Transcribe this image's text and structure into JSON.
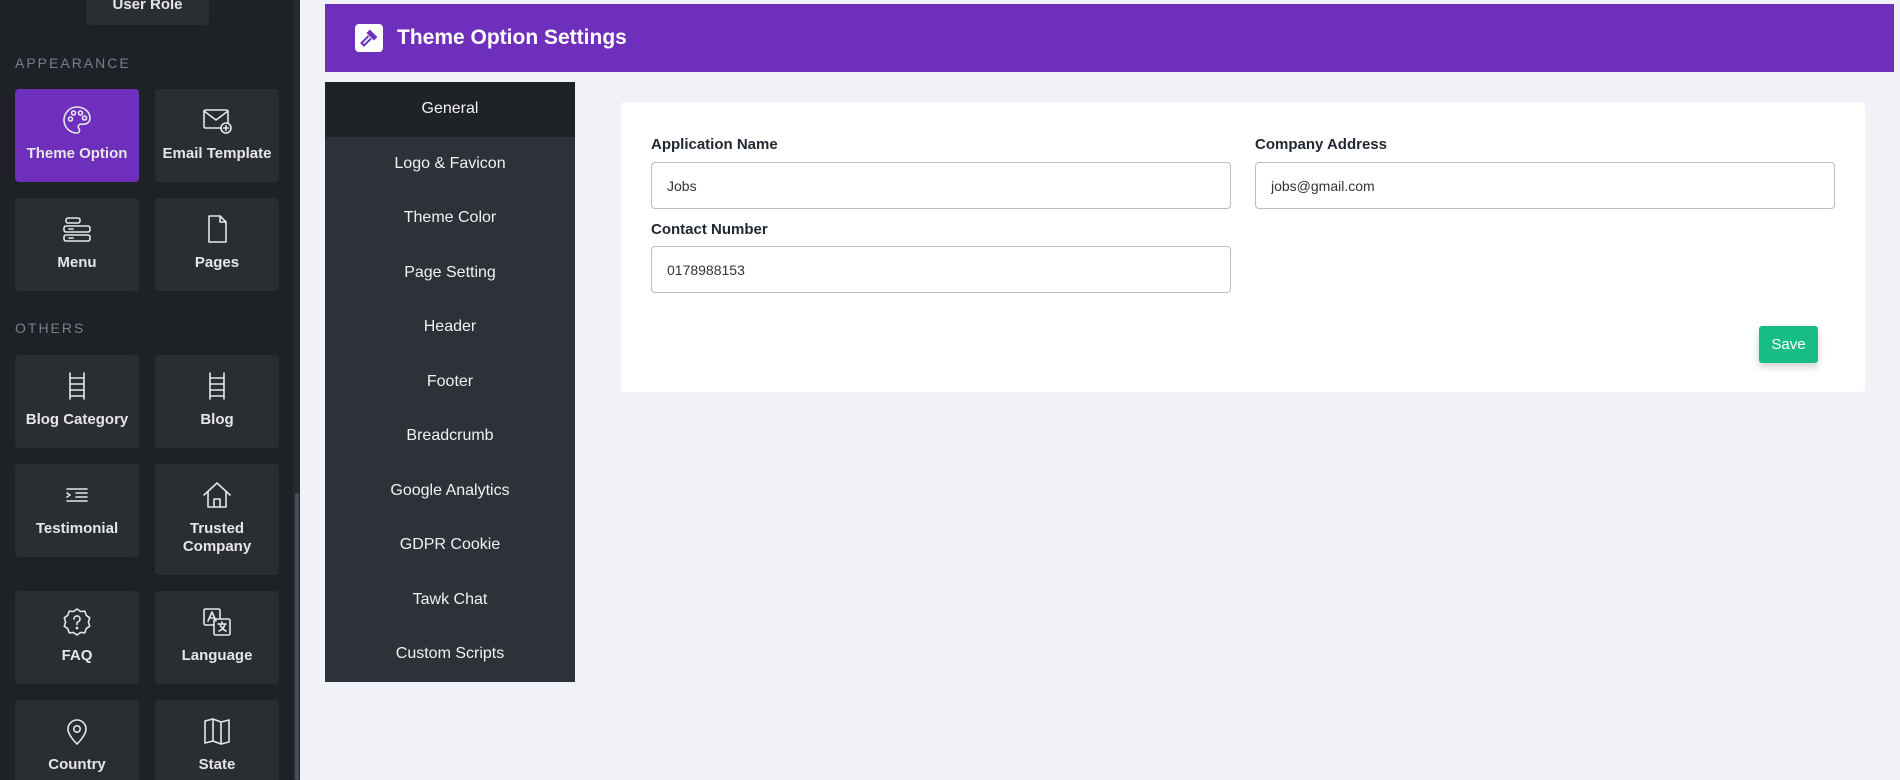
{
  "sidebar": {
    "partial_tile_label": "User Role",
    "appearance_label": "APPEARANCE",
    "others_label": "OTHERS",
    "tiles": [
      {
        "label": "Theme Option",
        "icon": "palette-icon",
        "active": true
      },
      {
        "label": "Email Template",
        "icon": "email-template-icon"
      },
      {
        "label": "Menu",
        "icon": "menu-icon"
      },
      {
        "label": "Pages",
        "icon": "page-icon"
      },
      {
        "label": "Blog Category",
        "icon": "ladder-icon"
      },
      {
        "label": "Blog",
        "icon": "ladder-icon"
      },
      {
        "label": "Testimonial",
        "icon": "quote-lines-icon"
      },
      {
        "label": "Trusted Company",
        "icon": "home-icon"
      },
      {
        "label": "FAQ",
        "icon": "question-badge-icon"
      },
      {
        "label": "Language",
        "icon": "translate-icon"
      },
      {
        "label": "Country",
        "icon": "map-pin-icon"
      },
      {
        "label": "State",
        "icon": "map-icon"
      }
    ]
  },
  "header": {
    "title": "Theme Option Settings",
    "icon": "gavel-icon",
    "color": "#6f2fbd"
  },
  "settings_menu": {
    "items": [
      {
        "label": "General",
        "active": true
      },
      {
        "label": "Logo & Favicon"
      },
      {
        "label": "Theme Color"
      },
      {
        "label": "Page Setting"
      },
      {
        "label": "Header"
      },
      {
        "label": "Footer"
      },
      {
        "label": "Breadcrumb"
      },
      {
        "label": "Google Analytics"
      },
      {
        "label": "GDPR Cookie"
      },
      {
        "label": "Tawk Chat"
      },
      {
        "label": "Custom Scripts"
      }
    ]
  },
  "form": {
    "application_name_label": "Application Name",
    "application_name_value": "Jobs",
    "company_address_label": "Company Address",
    "company_address_value": "jobs@gmail.com",
    "contact_number_label": "Contact Number",
    "contact_number_value": "0178988153",
    "save_label": "Save",
    "save_color": "#17bd85"
  }
}
